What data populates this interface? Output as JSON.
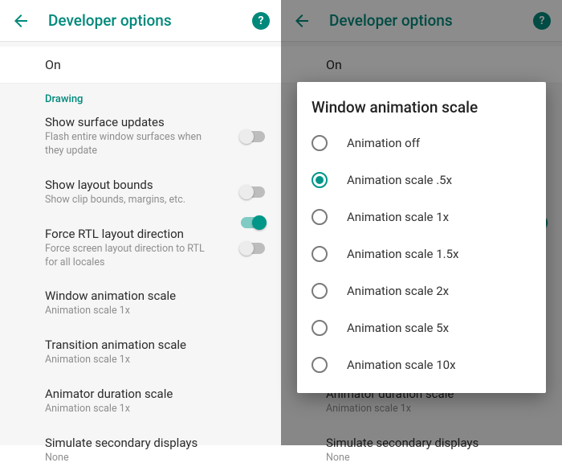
{
  "header": {
    "title": "Developer options"
  },
  "main_toggle": {
    "label": "On",
    "on": true
  },
  "section": {
    "drawing": "Drawing"
  },
  "items": [
    {
      "title": "Show surface updates",
      "sub": "Flash entire window surfaces when they update",
      "toggle": "off"
    },
    {
      "title": "Show layout bounds",
      "sub": "Show clip bounds, margins, etc.",
      "toggle": "off"
    },
    {
      "title": "Force RTL layout direction",
      "sub": "Force screen layout direction to RTL for all locales",
      "toggle": "off"
    },
    {
      "title": "Window animation scale",
      "sub": "Animation scale 1x"
    },
    {
      "title": "Transition animation scale",
      "sub": "Animation scale 1x"
    },
    {
      "title": "Animator duration scale",
      "sub": "Animation scale 1x"
    },
    {
      "title": "Simulate secondary displays",
      "sub": "None"
    }
  ],
  "dialog": {
    "title": "Window animation scale",
    "options": [
      {
        "label": "Animation off",
        "selected": false
      },
      {
        "label": "Animation scale .5x",
        "selected": true
      },
      {
        "label": "Animation scale 1x",
        "selected": false
      },
      {
        "label": "Animation scale 1.5x",
        "selected": false
      },
      {
        "label": "Animation scale 2x",
        "selected": false
      },
      {
        "label": "Animation scale 5x",
        "selected": false
      },
      {
        "label": "Animation scale 10x",
        "selected": false
      }
    ]
  }
}
